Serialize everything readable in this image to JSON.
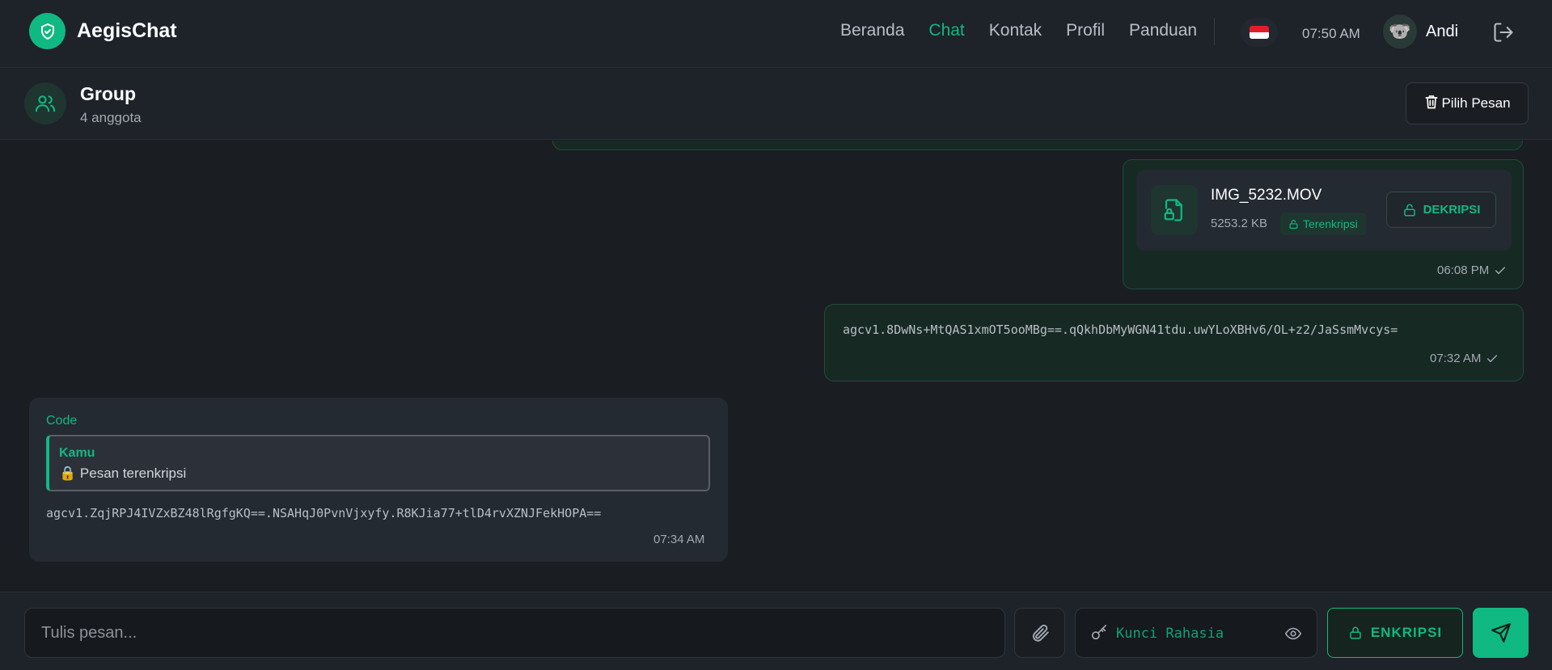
{
  "app": {
    "name": "AegisChat",
    "accent": "#10b981"
  },
  "nav": {
    "links": [
      "Beranda",
      "Chat",
      "Kontak",
      "Profil",
      "Panduan"
    ],
    "active": "Chat",
    "time": "07:50 AM",
    "user": "Andi",
    "avatar_emoji": "🐨"
  },
  "group": {
    "title": "Group",
    "members": "4 anggota",
    "select_button": "Pilih Pesan"
  },
  "messages": {
    "file": {
      "name": "IMG_5232.MOV",
      "size": "5253.2 KB",
      "badge": "Terenkripsi",
      "decrypt_label": "DEKRIPSI",
      "time": "06:08 PM"
    },
    "cipher_out": {
      "text": "agcv1.8DwNs+MtQAS1xmOT5ooMBg==.qQkhDbMyWGN41tdu.uwYLoXBHv6/OL+z2/JaSsmMvcys=",
      "time": "07:32 AM"
    },
    "incoming": {
      "sender": "Code",
      "quote_name": "Kamu",
      "quote_text": "Pesan terenkripsi",
      "quote_emoji": "🔒",
      "text": "agcv1.ZqjRPJ4IVZxBZ48lRgfgKQ==.NSAHqJ0PvnVjxyfy.R8KJia77+tlD4rvXZNJFekHOPA==",
      "time": "07:34 AM"
    }
  },
  "composer": {
    "message_placeholder": "Tulis pesan...",
    "key_placeholder": "Kunci Rahasia",
    "encrypt_label": "ENKRIPSI"
  },
  "icons": [
    "shield-icon",
    "users-icon",
    "trash-icon",
    "file-lock-icon",
    "lock-icon",
    "check-icon",
    "paperclip-icon",
    "key-icon",
    "eye-icon",
    "send-icon",
    "logout-icon"
  ]
}
